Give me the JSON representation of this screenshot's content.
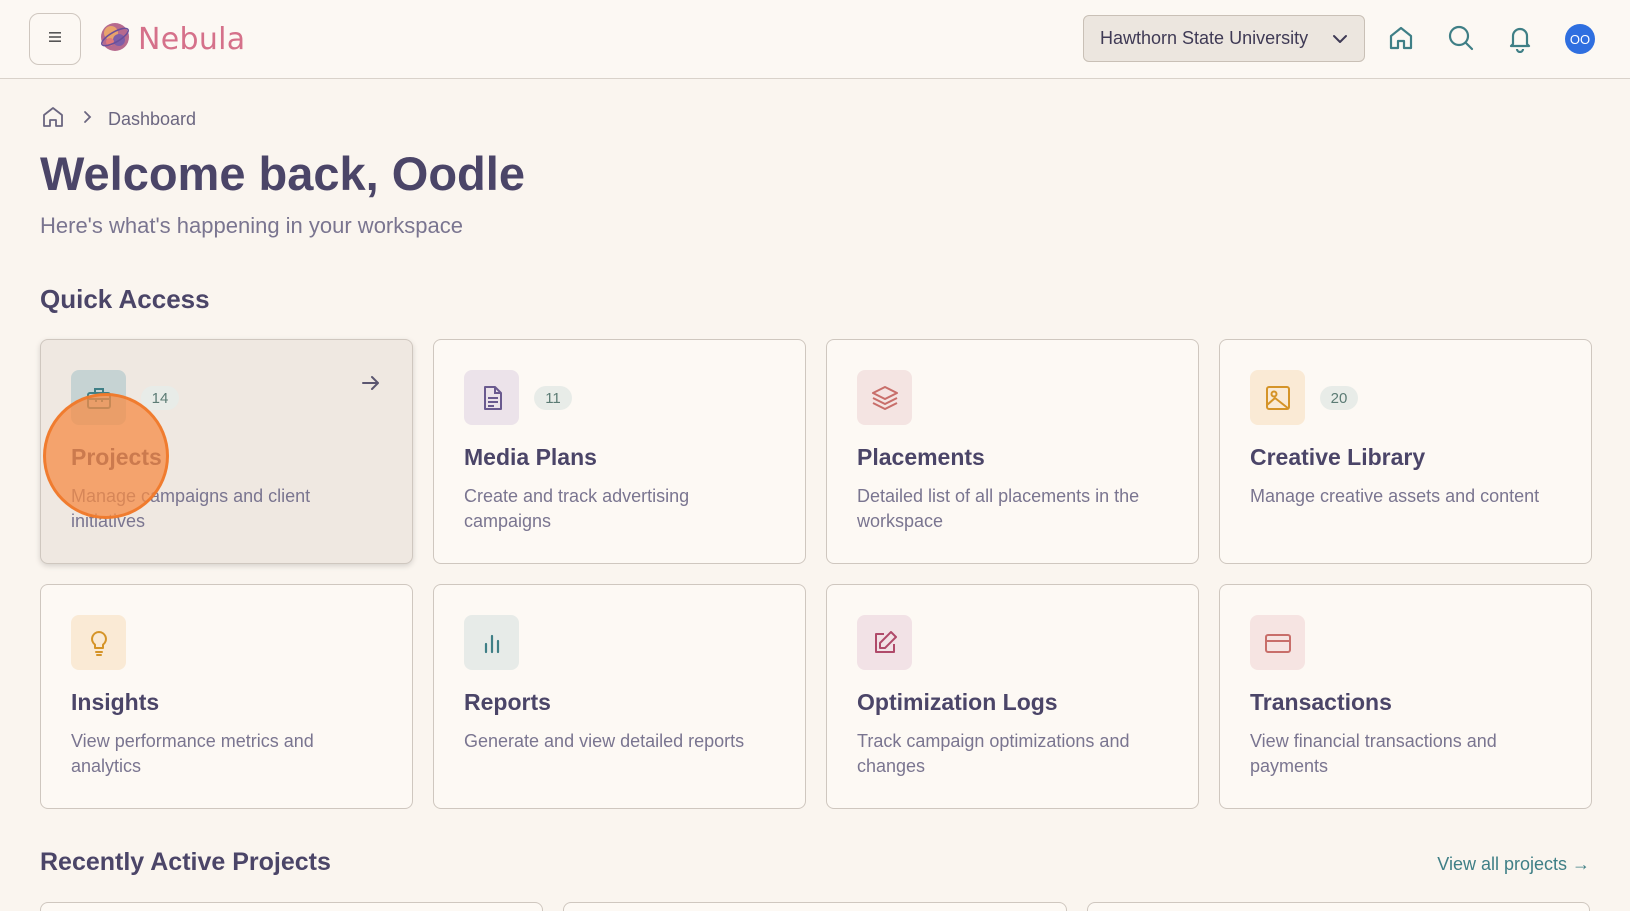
{
  "app": {
    "name": "Nebula"
  },
  "header": {
    "org_selected": "Hawthorn State University",
    "avatar_initials": "OO"
  },
  "breadcrumb": {
    "current": "Dashboard"
  },
  "page": {
    "title": "Welcome back, Oodle",
    "subtitle": "Here's what's happening in your workspace"
  },
  "quick_access": {
    "heading": "Quick Access",
    "cards": [
      {
        "title": "Projects",
        "desc": "Manage campaigns and client initiatives",
        "badge": "14",
        "icon": "briefcase-icon"
      },
      {
        "title": "Media Plans",
        "desc": "Create and track advertising campaigns",
        "badge": "11",
        "icon": "document-icon"
      },
      {
        "title": "Placements",
        "desc": "Detailed list of all placements in the workspace",
        "badge": "",
        "icon": "layers-icon"
      },
      {
        "title": "Creative Library",
        "desc": "Manage creative assets and content",
        "badge": "20",
        "icon": "image-icon"
      },
      {
        "title": "Insights",
        "desc": "View performance metrics and analytics",
        "badge": "",
        "icon": "lightbulb-icon"
      },
      {
        "title": "Reports",
        "desc": "Generate and view detailed reports",
        "badge": "",
        "icon": "bar-chart-icon"
      },
      {
        "title": "Optimization Logs",
        "desc": "Track campaign optimizations and changes",
        "badge": "",
        "icon": "edit-icon"
      },
      {
        "title": "Transactions",
        "desc": "View financial transactions and payments",
        "badge": "",
        "icon": "credit-card-icon"
      }
    ]
  },
  "recent": {
    "heading": "Recently Active Projects",
    "view_all": "View all projects →"
  },
  "colors": {
    "accent": "#3f7f86",
    "logo": "#d5718a",
    "avatar": "#2f6fe0",
    "cursor_highlight": "#f58c46"
  }
}
